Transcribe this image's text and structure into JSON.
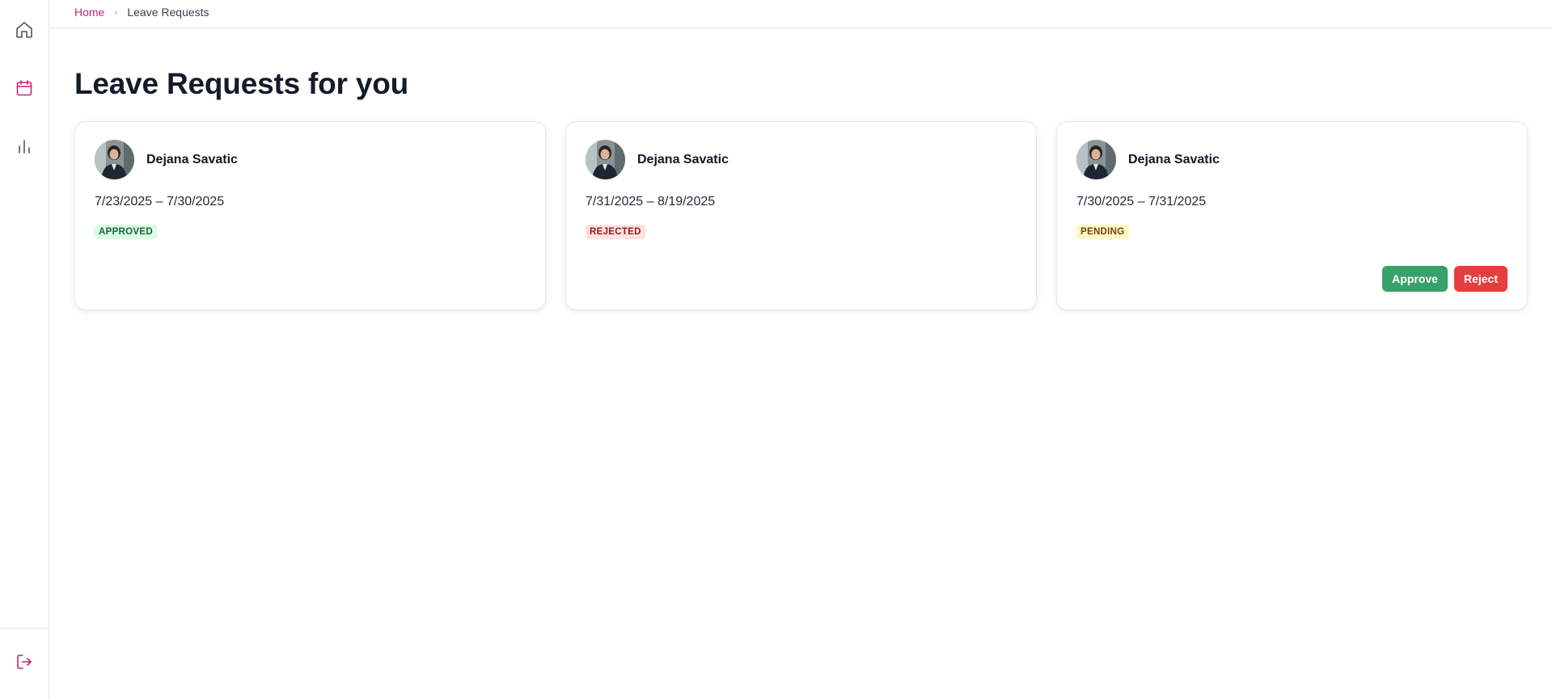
{
  "breadcrumb": {
    "home": "Home",
    "separator": "›",
    "current": "Leave Requests"
  },
  "page": {
    "title": "Leave Requests for you"
  },
  "sidebar": {
    "items": [
      {
        "icon": "home-icon",
        "active": false
      },
      {
        "icon": "calendar-icon",
        "active": true
      },
      {
        "icon": "bar-chart-icon",
        "active": false
      }
    ],
    "bottom": {
      "icon": "logout-icon"
    }
  },
  "requests": [
    {
      "name": "Dejana Savatic",
      "dates": "7/23/2025 – 7/30/2025",
      "status": "APPROVED"
    },
    {
      "name": "Dejana Savatic",
      "dates": "7/31/2025 – 8/19/2025",
      "status": "REJECTED"
    },
    {
      "name": "Dejana Savatic",
      "dates": "7/30/2025 – 7/31/2025",
      "status": "PENDING",
      "approve_label": "Approve",
      "reject_label": "Reject"
    }
  ],
  "colors": {
    "accent": "#c0267a",
    "approve": "#38a169",
    "reject": "#e53e3e",
    "approved_badge_bg": "#dcfce7",
    "rejected_badge_bg": "#fee2e2",
    "pending_badge_bg": "#fef9c3"
  }
}
